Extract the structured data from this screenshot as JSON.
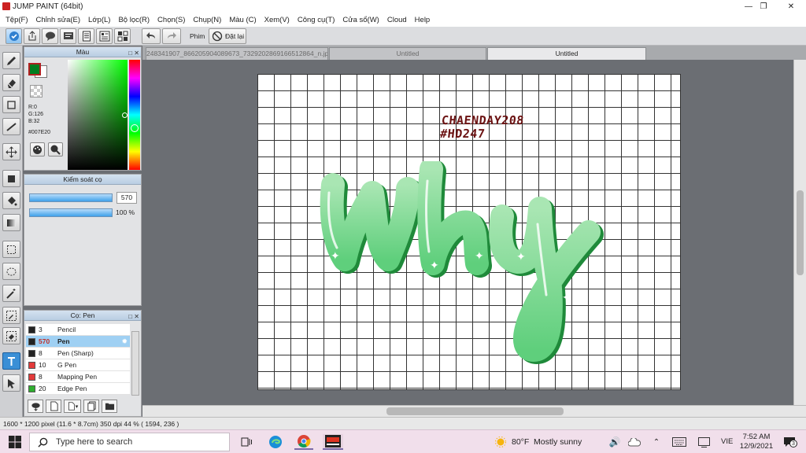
{
  "window": {
    "title": "JUMP PAINT (64bit)"
  },
  "menu": [
    "Tệp(F)",
    "Chỉnh sửa(E)",
    "Lớp(L)",
    "Bộ lọc(R)",
    "Chọn(S)",
    "Chụp(N)",
    "Màu (C)",
    "Xem(V)",
    "Công cụ(T)",
    "Cửa sổ(W)",
    "Cloud",
    "Help"
  ],
  "toolbar": {
    "phim_label": "Phim",
    "reset_label": "Đặt lại"
  },
  "color_panel": {
    "title": "Màu",
    "r": "R:0",
    "g": "G:126",
    "b": "B:32",
    "hex": "#007E20",
    "fg": "#007E20"
  },
  "brush_control": {
    "title": "Kiểm soát cọ",
    "size": "570",
    "opacity": "100 %",
    "opacity_fill": 1.0
  },
  "brush_list": {
    "title": "Cọ: Pen",
    "items": [
      {
        "size": "3",
        "name": "Pencil",
        "color": "#222222"
      },
      {
        "size": "570",
        "name": "Pen",
        "color": "#222222",
        "selected": true
      },
      {
        "size": "8",
        "name": "Pen (Sharp)",
        "color": "#222222"
      },
      {
        "size": "10",
        "name": "G Pen",
        "color": "#e33a3a"
      },
      {
        "size": "8",
        "name": "Mapping Pen",
        "color": "#e33a3a"
      },
      {
        "size": "20",
        "name": "Edge Pen",
        "color": "#2fae2f"
      }
    ]
  },
  "tabs": [
    {
      "label": "248341907_866205904089673_7329202869166512864_n.jpg",
      "active": false
    },
    {
      "label": "Untitled",
      "active": false
    },
    {
      "label": "Untitled",
      "active": true
    }
  ],
  "canvas": {
    "text_line1": "CHAENDAY208",
    "text_line2": "#HD247",
    "art_word": "why"
  },
  "status": {
    "text": "1600 * 1200 pixel   (11.6 * 8.7cm)   350 dpi   44 %   ( 1594, 236 )"
  },
  "taskbar": {
    "search_placeholder": "Type here to search",
    "weather_temp": "80°F",
    "weather_desc": "Mostly sunny",
    "lang": "VIE",
    "time": "7:52 AM",
    "date": "12/9/2021",
    "notif_count": "3"
  }
}
